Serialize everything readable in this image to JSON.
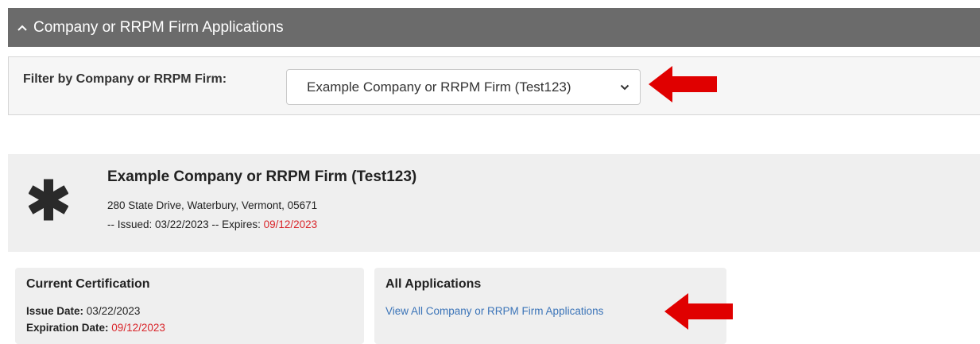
{
  "section": {
    "title": "Company or RRPM Firm Applications",
    "chevron_icon": "chevron-up-icon"
  },
  "filter": {
    "label": "Filter by Company or RRPM Firm:",
    "selected": "Example Company or RRPM Firm (Test123)",
    "chevron_icon": "chevron-down-icon"
  },
  "company": {
    "icon": "asterisk-icon",
    "name": "Example Company or RRPM Firm (Test123)",
    "address": "280 State Drive, Waterbury, Vermont, 05671",
    "issued_prefix": "-- Issued: ",
    "issued_date": "03/22/2023",
    "expires_prefix": " -- Expires: ",
    "expires_date": "09/12/2023"
  },
  "current_certification": {
    "title": "Current Certification",
    "issue_label": "Issue Date:",
    "issue_value": "03/22/2023",
    "expiration_label": "Expiration Date:",
    "expiration_value": "09/12/2023"
  },
  "all_applications": {
    "title": "All Applications",
    "link_text": "View All Company or RRPM Firm Applications"
  },
  "colors": {
    "header_bg": "#6b6b6b",
    "panel_bg": "#efefef",
    "expiry_red": "#d9252a",
    "link_blue": "#3b74b8",
    "arrow_red": "#e00000"
  }
}
